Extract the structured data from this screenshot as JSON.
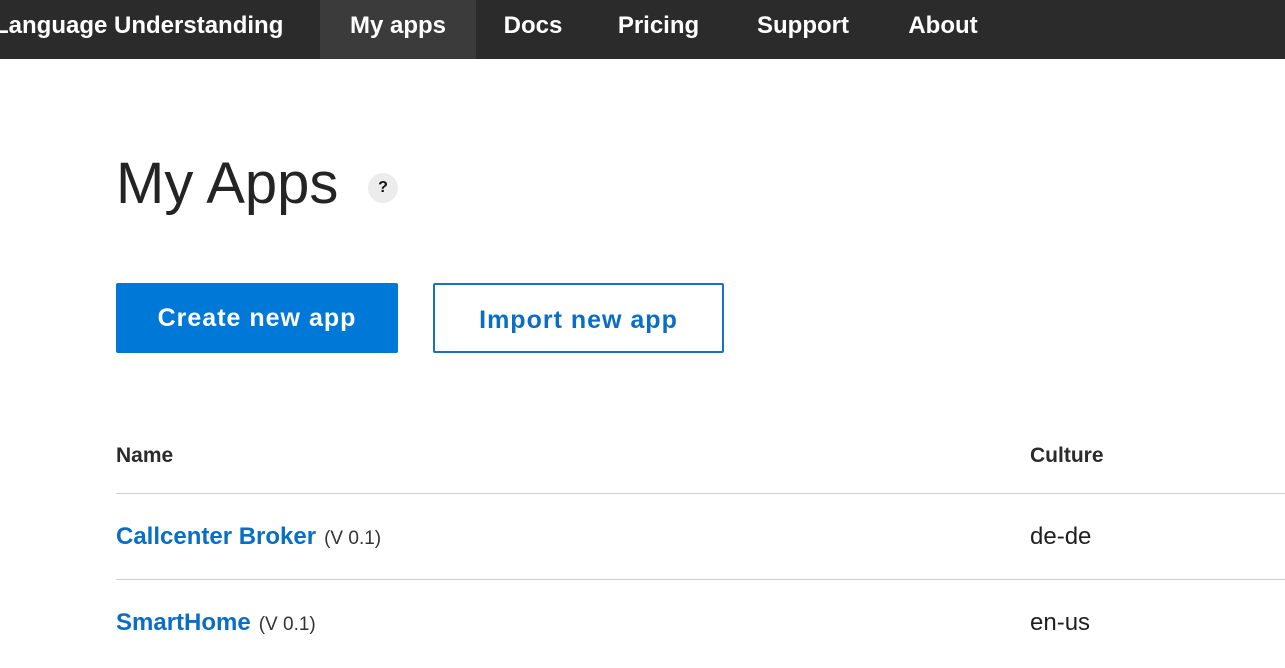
{
  "topnav": {
    "brand": "Language Understanding",
    "items": [
      {
        "label": "My apps",
        "active": true
      },
      {
        "label": "Docs",
        "active": false
      },
      {
        "label": "Pricing",
        "active": false
      },
      {
        "label": "Support",
        "active": false
      },
      {
        "label": "About",
        "active": false
      }
    ]
  },
  "main": {
    "title": "My Apps",
    "help_icon": "?",
    "buttons": {
      "create": "Create new app",
      "import": "Import new app"
    },
    "table": {
      "columns": [
        "Name",
        "Culture"
      ],
      "rows": [
        {
          "name": "Callcenter Broker",
          "version": "(V 0.1)",
          "culture": "de-de"
        },
        {
          "name": "SmartHome",
          "version": "(V 0.1)",
          "culture": "en-us"
        }
      ]
    }
  },
  "colors": {
    "nav_bg": "#2b2b2b",
    "nav_active_bg": "#3b3b3b",
    "accent": "#0078d7",
    "link": "#0a6ec4"
  }
}
